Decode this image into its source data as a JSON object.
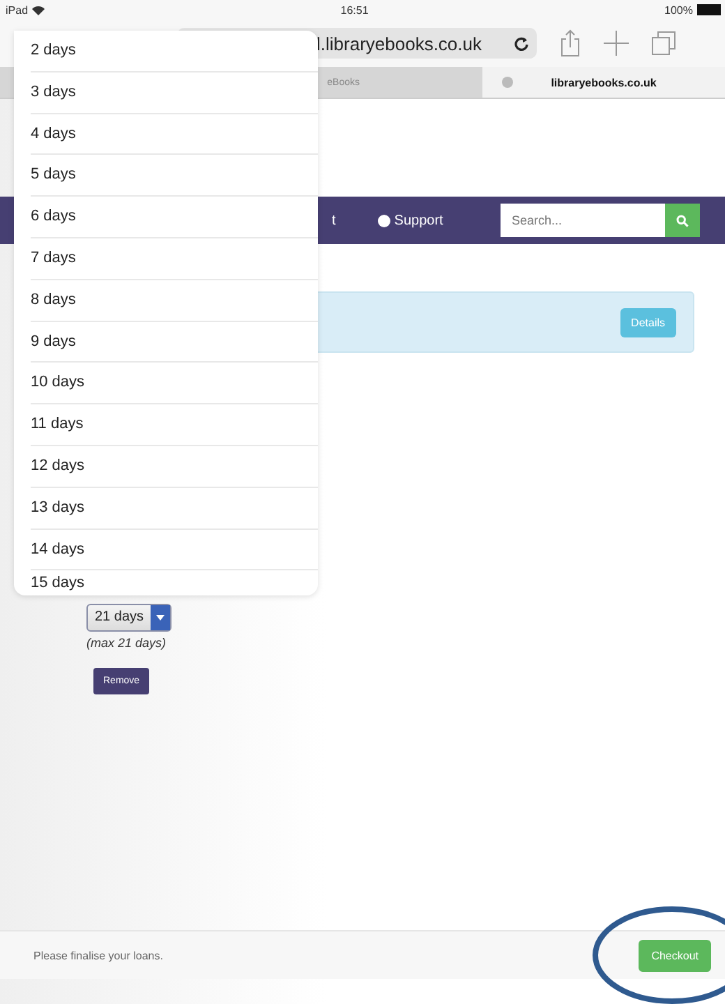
{
  "status_bar": {
    "device": "iPad",
    "time": "16:51",
    "battery": "100%"
  },
  "browser": {
    "url": "l.libraryebooks.co.uk",
    "tabs": [
      {
        "label": "eBooks",
        "selected": false
      },
      {
        "label": "libraryebooks.co.uk",
        "selected": true
      }
    ]
  },
  "navbar": {
    "items": [
      "t",
      "Support"
    ],
    "search": {
      "placeholder": "Search..."
    }
  },
  "alert": {
    "button": "Details"
  },
  "loan": {
    "select_value": "21 days",
    "note": "(max 21 days)",
    "remove_button": "Remove"
  },
  "dropdown": {
    "options": [
      {
        "label": "2 days",
        "selected": false
      },
      {
        "label": "3 days",
        "selected": false
      },
      {
        "label": "4 days",
        "selected": false
      },
      {
        "label": "5 days",
        "selected": false
      },
      {
        "label": "6 days",
        "selected": false
      },
      {
        "label": "7 days",
        "selected": false
      },
      {
        "label": "8 days",
        "selected": false
      },
      {
        "label": "9 days",
        "selected": false
      },
      {
        "label": "10 days",
        "selected": false
      },
      {
        "label": "11 days",
        "selected": false
      },
      {
        "label": "12 days",
        "selected": false
      },
      {
        "label": "13 days",
        "selected": false
      },
      {
        "label": "14 days",
        "selected": false
      },
      {
        "label": "15 days",
        "selected": false
      }
    ]
  },
  "footer": {
    "message": "Please finalise your loans.",
    "checkout_button": "Checkout"
  }
}
